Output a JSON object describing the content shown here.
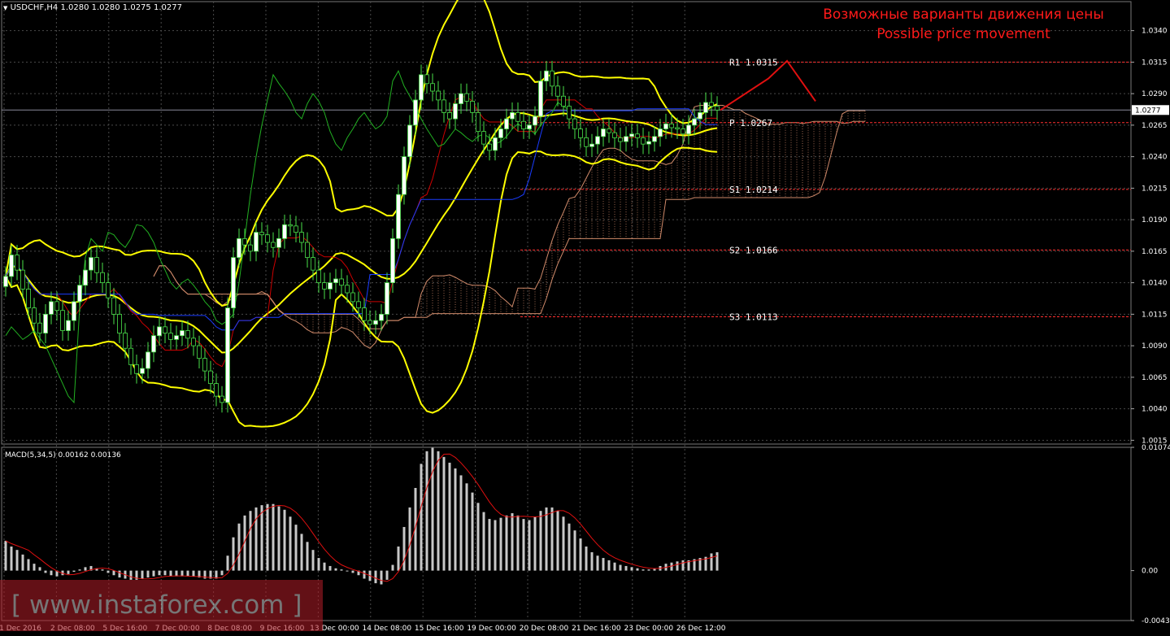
{
  "header": {
    "symbol_title": "USDCHF,H4",
    "ohlc": "1.0280 1.0280 1.0275 1.0277",
    "menu_icon": "triangle-down-icon"
  },
  "annotation": {
    "line_ru": "Возможные варианты движения цены",
    "line_en": "Possible price movement",
    "color": "#ff1a1a"
  },
  "watermark": {
    "text": "[ www.instaforex.com ]",
    "color": "#b41e28"
  },
  "colors": {
    "background": "#000000",
    "grid": "#4a4a4a",
    "bollinger": "#ffff00",
    "bull_candle": "#ffffff",
    "bear_candle": "#000000",
    "tenkan": "#cc0000",
    "kijun": "#1a3cff",
    "chikou": "#22b022",
    "cloud": "#d08a6a",
    "pivot_line": "#ff3030",
    "macd_hist": "#c8c8c8",
    "macd_signal": "#e01010"
  },
  "chart_data": [
    {
      "type": "candlestick",
      "title": "USDCHF,H4",
      "yaxis_ticks": [
        "1.0340",
        "1.0315",
        "1.0290",
        "1.0265",
        "1.0240",
        "1.0215",
        "1.0190",
        "1.0165",
        "1.0140",
        "1.0115",
        "1.0090",
        "1.0065",
        "1.0040",
        "1.0015"
      ],
      "ylim": [
        1.0012,
        1.0363
      ],
      "current_price": "1.0277",
      "x_ticks": [
        "1 Dec 2016",
        "2 Dec 08:00",
        "5 Dec 16:00",
        "7 Dec 00:00",
        "8 Dec 08:00",
        "9 Dec 16:00",
        "13 Dec 00:00",
        "14 Dec 08:00",
        "15 Dec 16:00",
        "19 Dec 00:00",
        "20 Dec 08:00",
        "21 Dec 16:00",
        "23 Dec 00:00",
        "26 Dec 12:00"
      ],
      "pivot_levels": [
        {
          "label": "R1",
          "value": "1.0315"
        },
        {
          "label": "P",
          "value": "1.0267"
        },
        {
          "label": "S1",
          "value": "1.0214"
        },
        {
          "label": "S2",
          "value": "1.0166"
        },
        {
          "label": "S3",
          "value": "1.0113"
        }
      ],
      "close": [
        1.0145,
        1.0162,
        1.015,
        1.0135,
        1.012,
        1.0108,
        1.01,
        1.0115,
        1.0125,
        1.0118,
        1.0102,
        1.011,
        1.0125,
        1.0138,
        1.015,
        1.016,
        1.0148,
        1.014,
        1.0128,
        1.0115,
        1.01,
        1.0088,
        1.0075,
        1.0068,
        1.0072,
        1.0085,
        1.0098,
        1.0105,
        1.01,
        1.0095,
        1.0098,
        1.0102,
        1.0096,
        1.009,
        1.008,
        1.007,
        1.006,
        1.005,
        1.0045,
        1.012,
        1.016,
        1.0175,
        1.017,
        1.0165,
        1.018,
        1.0178,
        1.0172,
        1.0168,
        1.0175,
        1.0186,
        1.0185,
        1.018,
        1.0172,
        1.016,
        1.015,
        1.014,
        1.0135,
        1.014,
        1.0143,
        1.0138,
        1.0132,
        1.0125,
        1.012,
        1.011,
        1.0107,
        1.011,
        1.0115,
        1.014,
        1.0175,
        1.021,
        1.024,
        1.0265,
        1.0285,
        1.0305,
        1.0298,
        1.0292,
        1.0285,
        1.0275,
        1.027,
        1.0282,
        1.029,
        1.0284,
        1.0275,
        1.026,
        1.025,
        1.0245,
        1.0255,
        1.0262,
        1.027,
        1.0275,
        1.0268,
        1.0262,
        1.0265,
        1.0272,
        1.03,
        1.0308,
        1.0296,
        1.0288,
        1.028,
        1.027,
        1.0262,
        1.0255,
        1.0248,
        1.025,
        1.0256,
        1.0262,
        1.0259,
        1.0255,
        1.0252,
        1.0256,
        1.0258,
        1.0255,
        1.025,
        1.0252,
        1.0256,
        1.0262,
        1.0266,
        1.0263,
        1.0262,
        1.0258,
        1.0265,
        1.027,
        1.0275,
        1.0283,
        1.028,
        1.0277
      ],
      "bollinger_bands": [
        "upper",
        "middle",
        "lower"
      ],
      "ichimoku_lines": [
        "tenkan",
        "kijun",
        "chikou",
        "cloud"
      ]
    },
    {
      "type": "bar",
      "title": "MACD(5,34,5) 0.00162 0.00136",
      "yaxis_ticks": [
        "0.01074",
        "0.00",
        "-0.00435"
      ],
      "ylim": [
        -0.00435,
        0.01074
      ],
      "histogram": [
        0.0026,
        0.0021,
        0.0018,
        0.0014,
        0.001,
        0.0006,
        0.0003,
        -0.0002,
        -0.0004,
        -0.0005,
        -0.0004,
        -0.0003,
        -0.0001,
        0.0001,
        0.0003,
        0.0004,
        0.0002,
        0.0001,
        -0.0002,
        -0.0004,
        -0.0006,
        -0.0007,
        -0.0008,
        -0.0008,
        -0.0007,
        -0.0006,
        -0.0005,
        -0.0004,
        -0.0004,
        -0.0005,
        -0.0005,
        -0.0005,
        -0.0005,
        -0.0005,
        -0.0006,
        -0.0007,
        -0.0007,
        -0.0007,
        -0.0004,
        0.0013,
        0.0029,
        0.0041,
        0.0048,
        0.0052,
        0.0055,
        0.0057,
        0.0058,
        0.0058,
        0.0056,
        0.0053,
        0.0047,
        0.004,
        0.0032,
        0.0025,
        0.0018,
        0.0011,
        0.0007,
        0.0004,
        0.0002,
        0.0001,
        0.0,
        -0.0002,
        -0.0004,
        -0.0007,
        -0.0009,
        -0.0011,
        -0.0012,
        -0.0008,
        0.0005,
        0.0021,
        0.0038,
        0.0055,
        0.0072,
        0.0093,
        0.0104,
        0.0107,
        0.0104,
        0.0099,
        0.0094,
        0.0089,
        0.0083,
        0.0076,
        0.0068,
        0.0059,
        0.0051,
        0.0045,
        0.0044,
        0.0046,
        0.0048,
        0.005,
        0.0048,
        0.0045,
        0.0044,
        0.0047,
        0.0052,
        0.0055,
        0.0055,
        0.0052,
        0.0047,
        0.0041,
        0.0035,
        0.0028,
        0.0021,
        0.0016,
        0.0013,
        0.0011,
        0.0009,
        0.0007,
        0.0005,
        0.0004,
        0.0003,
        0.0002,
        0.0001,
        0.0001,
        0.0002,
        0.0004,
        0.0006,
        0.0007,
        0.0008,
        0.0009,
        0.0009,
        0.001,
        0.0011,
        0.0012,
        0.0015,
        0.0016
      ]
    }
  ]
}
